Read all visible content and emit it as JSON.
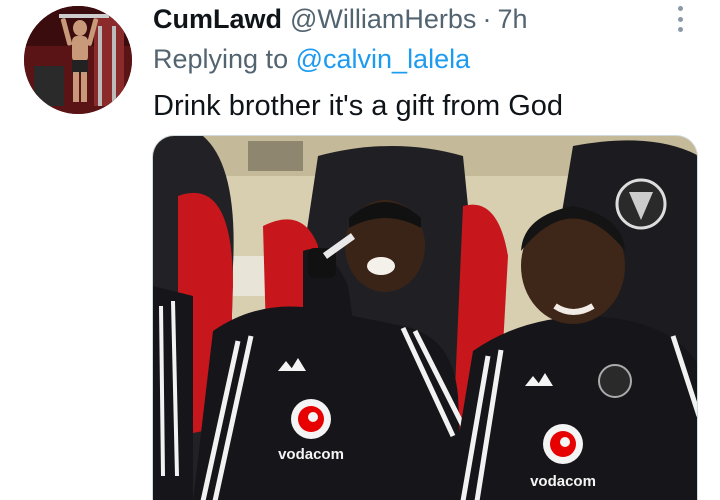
{
  "tweet": {
    "display_name": "CumLawd",
    "handle": "@WilliamHerbs",
    "separator": "·",
    "time": "7h",
    "reply_prefix": "Replying to",
    "reply_to": "@calvin_lalela",
    "text": "Drink brother it's a gift from God"
  },
  "media": {
    "sponsor_left": "vodacom",
    "sponsor_right": "vodacom",
    "brand_mark": "adidas"
  },
  "colors": {
    "link": "#1d9bf0",
    "secondary_text": "#536471",
    "primary_text": "#0f1419",
    "seat_red": "#c8161d",
    "jersey": "#16161a"
  },
  "icons": {
    "more": "more-vertical-icon",
    "avatar": "profile-avatar-image"
  }
}
